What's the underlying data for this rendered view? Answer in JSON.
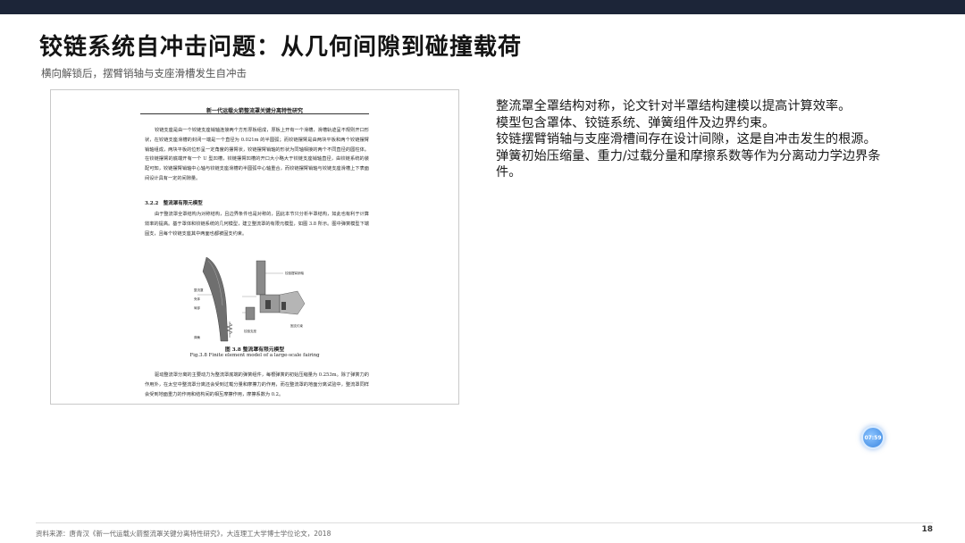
{
  "slide": {
    "title": "铰链系统自冲击问题：从几何间隙到碰撞载荷",
    "subtitle": "横向解锁后，摆臂销轴与支座滑槽发生自冲击"
  },
  "paper": {
    "header": "新一代运载火箭整流罩关键分离特性研究",
    "paragraph1": "铰链支座是由一个铰链支座销轴连接两个方形厚板组成，厚板上开有一个滑槽，滑槽轨迹呈不规则开口形状，在铰链支座滑槽的封闭一端是一个直径为 0.021m 的半圆弧；而铰链摆臂是由两块平板和两个铰链摆臂销轴组成，两块平板的位形呈一定角度的摆臂状，铰链摆臂销轴的形状为同轴相接的两个不同直径的圆柱体。在铰链摆臂的底端开有一个 U 型凹槽，铰链摆臂凹槽的开口大小略大于铰链支座销轴直径，由铰链系统的装配可知，铰链摆臂销轴中心轴与铰链支座滑槽的半圆弧中心轴重合，而铰链摆臂销轴与铰链支座滑槽上下表面间设计具有一定的间隙量。",
    "section_heading": "3.2.2　整流罩有限元模型",
    "paragraph2": "由于整流罩全罩结构为对称结构，且边界条件也是对称的，因此本节只分析半罩结构，如此也有利于计算效率的提高。基于罩体和铰链系统的几何模型，建立整流罩的有限元模型，如图 3.8 所示。图中弹簧模型下端固支，且每个铰链支座其中两面也都被固支约束。",
    "figure_labels": [
      "整流罩",
      "壳体",
      "局部",
      "弹簧",
      "铰链摆臂销轴",
      "铰链支座",
      "固支约束"
    ],
    "figure_caption_cn": "图 3.8 整流罩有限元模型",
    "figure_caption_en": "Fig.3.8 Finite element model of a large-scale fairing",
    "paragraph3": "驱动整流罩分离的主要动力为整流罩底端的弹簧组件，每根弹簧的初始压缩量为 0.253m。除了弹簧力的作用外，在太空中整流罩分离还会受到过载分量和摩擦力的作用，而在整流罩的地面分离试验中，整流罩同样会受到地面重力的作用和结构间的相互摩擦作用，摩擦系数为 0.2。"
  },
  "bullets": [
    "整流罩全罩结构对称，论文针对半罩结构建模以提高计算效率。",
    "模型包含罩体、铰链系统、弹簧组件及边界约束。",
    "铰链摆臂销轴与支座滑槽间存在设计间隙，这是自冲击发生的根源。",
    "弹簧初始压缩量、重力/过载分量和摩擦系数等作为分离动力学边界条件。"
  ],
  "assistant_button": {
    "label": "07:59",
    "icon": "assistant-bubble-icon"
  },
  "footer": {
    "source": "资料来源：唐青汉《新一代运载火箭整流罩关键分离特性研究》，大连理工大学博士学位论文，2018",
    "page_number": "18"
  },
  "colors": {
    "topbar": "#1c2538",
    "title": "#141414",
    "accent_button": "#3a86e0"
  }
}
